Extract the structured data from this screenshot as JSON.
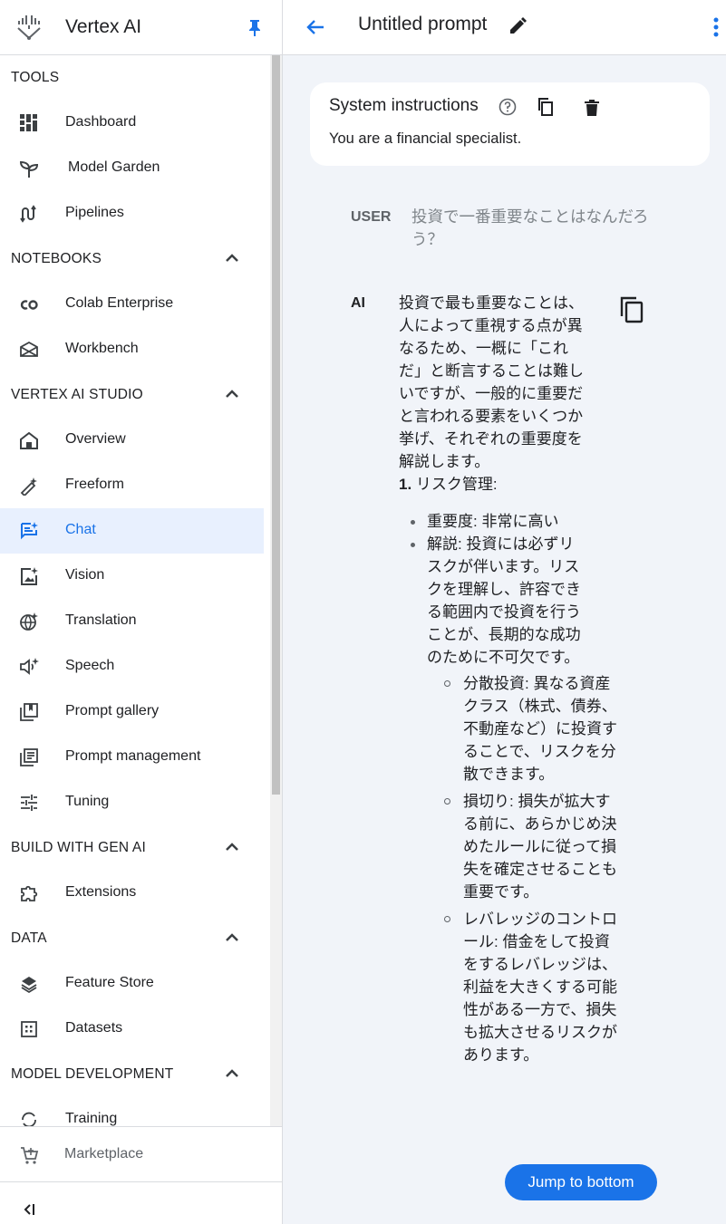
{
  "app": {
    "title": "Vertex AI"
  },
  "sidebar": {
    "sections": [
      {
        "label": "TOOLS",
        "collapsible": false,
        "items": [
          {
            "label": "Dashboard",
            "icon": "dashboard-icon"
          },
          {
            "label": "Model Garden",
            "icon": "sprout-icon"
          },
          {
            "label": "Pipelines",
            "icon": "pipelines-icon"
          }
        ]
      },
      {
        "label": "NOTEBOOKS",
        "collapsible": true,
        "items": [
          {
            "label": "Colab Enterprise",
            "icon": "colab-icon"
          },
          {
            "label": "Workbench",
            "icon": "workbench-icon"
          }
        ]
      },
      {
        "label": "VERTEX AI STUDIO",
        "collapsible": true,
        "items": [
          {
            "label": "Overview",
            "icon": "home-icon"
          },
          {
            "label": "Freeform",
            "icon": "magic-pen-icon"
          },
          {
            "label": "Chat",
            "icon": "chat-icon",
            "active": true
          },
          {
            "label": "Vision",
            "icon": "vision-icon"
          },
          {
            "label": "Translation",
            "icon": "translate-icon"
          },
          {
            "label": "Speech",
            "icon": "speech-icon"
          },
          {
            "label": "Prompt gallery",
            "icon": "gallery-icon"
          },
          {
            "label": "Prompt management",
            "icon": "prompt-management-icon"
          },
          {
            "label": "Tuning",
            "icon": "tune-icon"
          }
        ]
      },
      {
        "label": "BUILD WITH GEN AI",
        "collapsible": true,
        "items": [
          {
            "label": "Extensions",
            "icon": "extension-icon"
          }
        ]
      },
      {
        "label": "DATA",
        "collapsible": true,
        "items": [
          {
            "label": "Feature Store",
            "icon": "layers-icon"
          },
          {
            "label": "Datasets",
            "icon": "dataset-icon"
          }
        ]
      },
      {
        "label": "MODEL DEVELOPMENT",
        "collapsible": true,
        "items": [
          {
            "label": "Training",
            "icon": "training-icon"
          }
        ]
      }
    ],
    "footer": {
      "label": "Marketplace",
      "icon": "cart-icon"
    }
  },
  "header": {
    "title": "Untitled prompt"
  },
  "system_instructions": {
    "title": "System instructions",
    "text": "You are a financial specialist."
  },
  "conversation": {
    "user": {
      "role": "USER",
      "text": "投資で一番重要なことはなんだろう？"
    },
    "ai": {
      "role": "AI",
      "intro": "投資で最も重要なことは、人によって重視する点が異なるため、一概に「これだ」と断言することは難しいですが、一般的に重要だと言われる要素をいくつか挙げ、それぞれの重要度を解説します。",
      "heading_number": "1.",
      "heading_text": "リスク管理:",
      "bullets": [
        "重要度: 非常に高い",
        "解説: 投資には必ずリスクが伴います。リスクを理解し、許容できる範囲内で投資を行うことが、長期的な成功のために不可欠です。"
      ],
      "subbullets": [
        "分散投資: 異なる資産クラス（株式、債券、不動産など）に投資することで、リスクを分散できます。",
        "損切り: 損失が拡大する前に、あらかじめ決めたルールに従って損失を確定させることも重要です。",
        "レバレッジのコントロール: 借金をして投資をするレバレッジは、利益を大きくする可能性がある一方で、損失も拡大させるリスクがあります。"
      ]
    }
  },
  "jump_button": {
    "label": "Jump to bottom"
  },
  "colors": {
    "accent": "#1a73e8",
    "active_bg": "#e8f0fe",
    "main_bg": "#f1f4f9"
  }
}
